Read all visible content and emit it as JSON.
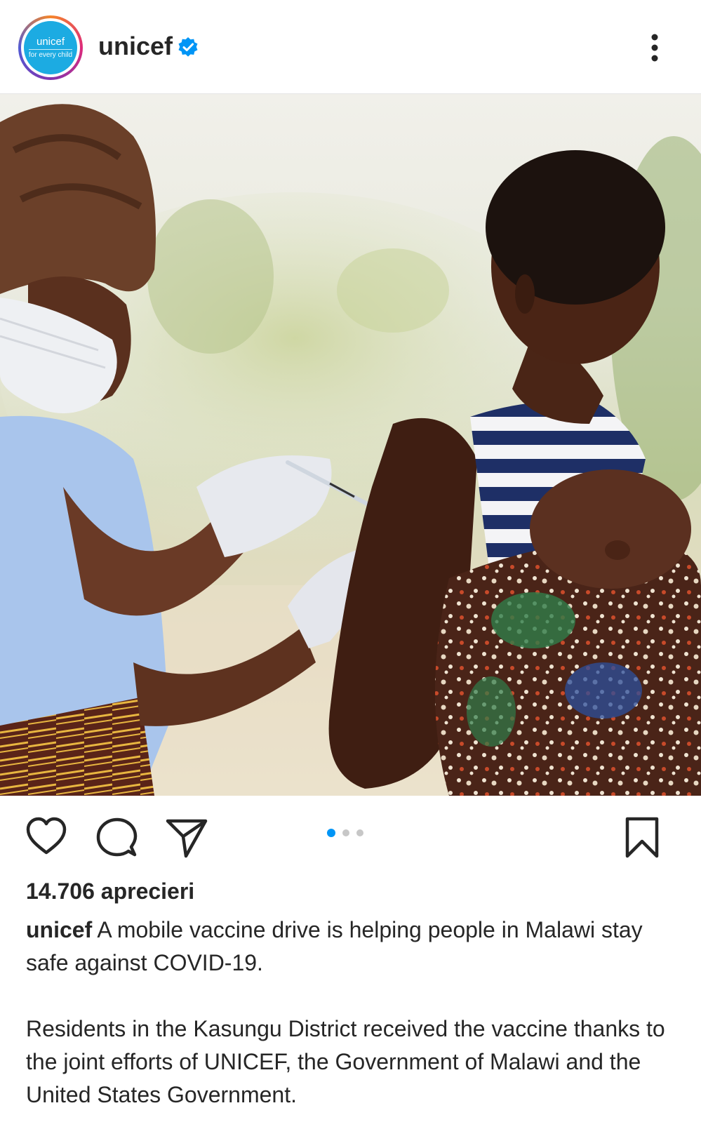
{
  "account": {
    "username": "unicef",
    "avatar_brand": "unicef",
    "avatar_tagline": "for every child",
    "verified_icon": "verified-badge-icon",
    "more_icon": "more-vertical-icon"
  },
  "post": {
    "image_description_icon": "post-photo",
    "carousel": {
      "count": 3,
      "active_index": 0
    },
    "likes": "14.706 aprecieri",
    "caption_author": "unicef",
    "caption_text": " A mobile vaccine drive is helping people in Malawi stay safe against COVID-19.",
    "caption_paragraph_2": "Residents in the Kasungu District received the vaccine thanks to the joint efforts of UNICEF, the Government of Malawi and the United States Government."
  },
  "actions": {
    "like_icon": "heart-icon",
    "comment_icon": "comment-icon",
    "share_icon": "send-icon",
    "save_icon": "bookmark-icon"
  },
  "colors": {
    "text": "#262626",
    "accent_blue": "#0095f6",
    "dot_inactive": "#c7c7c7",
    "unicef_blue": "#1cabe2"
  }
}
